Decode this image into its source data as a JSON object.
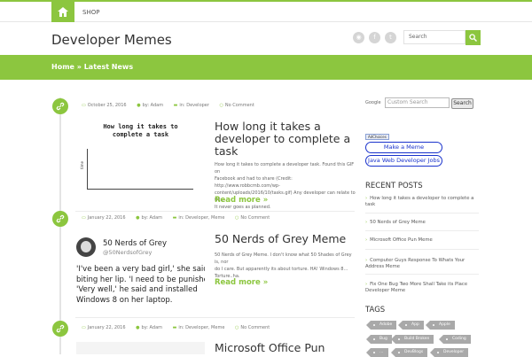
{
  "topnav": {
    "home_icon": "home-icon",
    "shop_label": "SHOP"
  },
  "header": {
    "site_title": "Developer Memes",
    "social": [
      {
        "name": "rss-icon",
        "glyph": "◉"
      },
      {
        "name": "facebook-icon",
        "glyph": "f"
      },
      {
        "name": "twitter-icon",
        "glyph": "t"
      }
    ],
    "search_placeholder": "Search"
  },
  "breadcrumb": {
    "text": "Home » Latest News"
  },
  "posts": [
    {
      "date": "October 25, 2016",
      "author": "by: Adam",
      "category": "in: Developer",
      "comments": "No Comment",
      "title_lines": [
        "How long it takes a",
        "developer to complete a",
        "task"
      ],
      "excerpt_lines": [
        "How long it takes to complete a developer task. Found this GIF on",
        "Facebook and had to share (Credit: http://www.robbcmb.com/wp-",
        "content/uploads/2016/10/tasks.gif) Any developer can relate to this.",
        "It never goes as planned."
      ],
      "read_more": "Read more »",
      "thumb": {
        "title_lines": [
          "How long it takes to",
          "complete a task"
        ],
        "ylabel": "time"
      }
    },
    {
      "date": "January 22, 2016",
      "author": "by: Adam",
      "category": "in: Developer, Meme",
      "comments": "No Comment",
      "title_lines": [
        "50 Nerds of Grey Meme"
      ],
      "excerpt_lines": [
        "50 Nerds of Grey Meme. I don't know what 50 Shades of Grey is, nor",
        "do I care. But apparently its about torture. HA! Windows 8…",
        "Torture..ha."
      ],
      "read_more": "Read more »",
      "thumb": {
        "name": "50 Nerds of Grey",
        "handle": "@50NerdsofGrey",
        "quote_lines": [
          "'I've been a very bad girl,' she said,",
          "biting her lip. 'I need to be punished.'",
          "'Very well,' he said and installed",
          "Windows 8 on her laptop."
        ]
      }
    },
    {
      "date": "January 22, 2016",
      "author": "by: Adam",
      "category": "in: Developer, Meme",
      "comments": "No Comment",
      "title_lines": [
        "Microsoft Office Pun"
      ]
    }
  ],
  "sidebar": {
    "google_label": "Google",
    "custom_search_placeholder": "Custom Search",
    "search_button": "Search",
    "adchoices": "AdChoices",
    "ad_links": [
      "Make a Meme",
      "Java Web Developer Jobs"
    ],
    "recent_title": "RECENT POSTS",
    "recent_posts": [
      [
        "How long it takes a developer to complete a",
        "task"
      ],
      [
        "50 Nerds of Grey Meme"
      ],
      [
        "Microsoft Office Pun Meme"
      ],
      [
        "Computer Guys Response To Whats Your",
        "Address Meme"
      ],
      [
        "Fix One Bug Two More Shall Take its Place",
        "Developer Meme"
      ]
    ],
    "tags_title": "TAGS",
    "tags": [
      "Adobe",
      "App",
      "Apple",
      "Bug",
      "Build Broken",
      "Coding",
      "…",
      "DevBlogs",
      "Developer"
    ]
  },
  "colors": {
    "accent": "#8cc63f",
    "link": "#1a33cc",
    "tag_bg": "#a9a9a9"
  }
}
